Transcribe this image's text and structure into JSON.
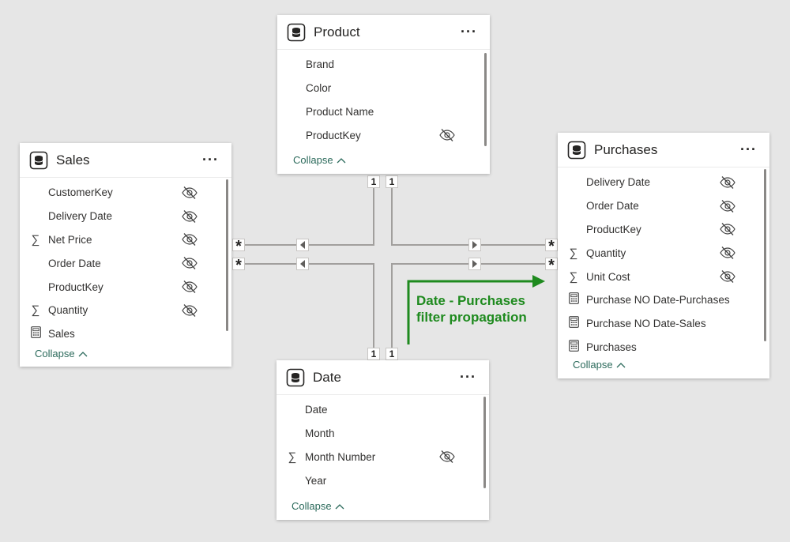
{
  "tables": {
    "product": {
      "title": "Product",
      "more": "···",
      "fields": [
        {
          "name": "Brand",
          "icon": "",
          "hidden": false
        },
        {
          "name": "Color",
          "icon": "",
          "hidden": false
        },
        {
          "name": "Product Name",
          "icon": "",
          "hidden": false
        },
        {
          "name": "ProductKey",
          "icon": "",
          "hidden": true
        }
      ],
      "collapse": "Collapse"
    },
    "sales": {
      "title": "Sales",
      "more": "···",
      "fields": [
        {
          "name": "CustomerKey",
          "icon": "",
          "hidden": true
        },
        {
          "name": "Delivery Date",
          "icon": "",
          "hidden": true
        },
        {
          "name": "Net Price",
          "icon": "sigma-icon",
          "hidden": true
        },
        {
          "name": "Order Date",
          "icon": "",
          "hidden": true
        },
        {
          "name": "ProductKey",
          "icon": "",
          "hidden": true
        },
        {
          "name": "Quantity",
          "icon": "sigma-icon",
          "hidden": true
        },
        {
          "name": "Sales",
          "icon": "calculator-icon",
          "hidden": false
        }
      ],
      "collapse": "Collapse"
    },
    "purchases": {
      "title": "Purchases",
      "more": "···",
      "fields": [
        {
          "name": "Delivery Date",
          "icon": "",
          "hidden": true
        },
        {
          "name": "Order Date",
          "icon": "",
          "hidden": true
        },
        {
          "name": "ProductKey",
          "icon": "",
          "hidden": true
        },
        {
          "name": "Quantity",
          "icon": "sigma-icon",
          "hidden": true
        },
        {
          "name": "Unit Cost",
          "icon": "sigma-icon",
          "hidden": true
        },
        {
          "name": "Purchase NO Date-Purchases",
          "icon": "calculator-icon",
          "hidden": false
        },
        {
          "name": "Purchase NO Date-Sales",
          "icon": "calculator-icon",
          "hidden": false
        },
        {
          "name": "Purchases",
          "icon": "calculator-icon",
          "hidden": false
        }
      ],
      "collapse": "Collapse"
    },
    "date": {
      "title": "Date",
      "more": "···",
      "fields": [
        {
          "name": "Date",
          "icon": "",
          "hidden": false
        },
        {
          "name": "Month",
          "icon": "",
          "hidden": false
        },
        {
          "name": "Month Number",
          "icon": "sigma-icon",
          "hidden": true
        },
        {
          "name": "Year",
          "icon": "",
          "hidden": false
        }
      ],
      "collapse": "Collapse"
    }
  },
  "cardinality": {
    "one": "1",
    "many": "*"
  },
  "annotation": {
    "line1": "Date - Purchases",
    "line2": "filter propagation"
  },
  "colors": {
    "annotation": "#1e8a1e",
    "lines": "#a19f9d",
    "collapse": "#2b6a5b"
  }
}
